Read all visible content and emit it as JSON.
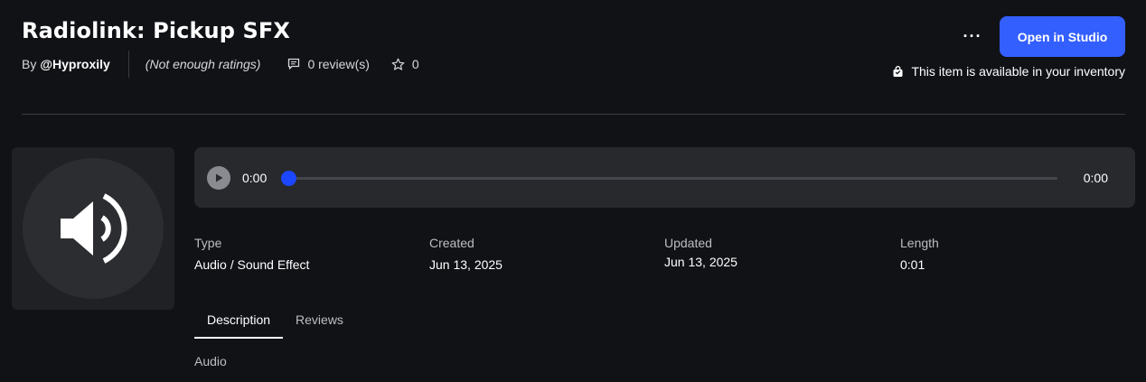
{
  "item": {
    "title": "Radiolink: Pickup SFX",
    "creator_prefix": "By",
    "creator": "@Hyproxily",
    "ratings": "(Not enough ratings)",
    "reviews": "0 review(s)",
    "favorites": "0"
  },
  "actions": {
    "more_label": "···",
    "open_label": "Open in Studio",
    "inventory_note": "This item is available in your inventory"
  },
  "player": {
    "current_time": "0:00",
    "total_time": "0:00",
    "progress": 0
  },
  "details": [
    {
      "label": "Type",
      "value": "Audio / Sound Effect"
    },
    {
      "label": "Created",
      "value": "Jun 13, 2025"
    },
    {
      "label": "Updated",
      "value": "Jun 13, 2025"
    },
    {
      "label": "Length",
      "value": "0:01"
    }
  ],
  "tabs": [
    {
      "label": "Description",
      "active": true
    },
    {
      "label": "Reviews",
      "active": false
    }
  ],
  "description": "Audio",
  "colors": {
    "background": "#111216",
    "accent": "#335fff",
    "panel": "#28292d"
  },
  "icons": {
    "thumbnail": "speaker-icon",
    "reviews": "comment-icon",
    "favorites": "star-icon",
    "inventory": "bag-icon",
    "play": "play-icon"
  }
}
